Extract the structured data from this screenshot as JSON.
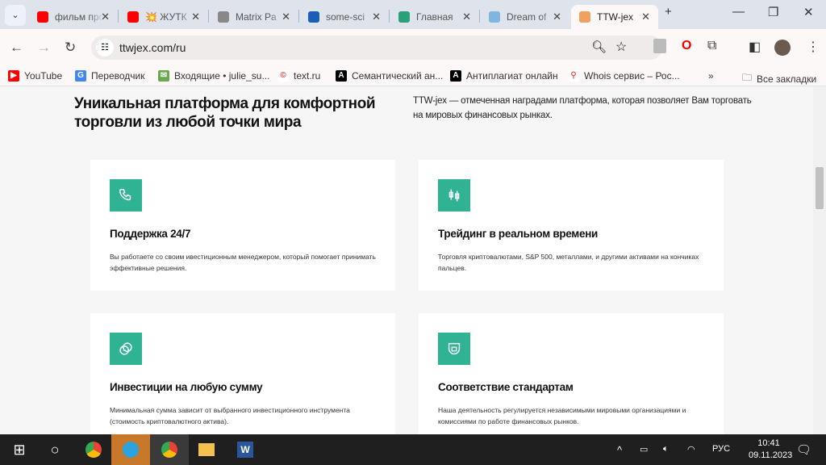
{
  "browser": {
    "tabs": [
      {
        "title": "фильм про",
        "icon": "youtube-icon",
        "color": "#ff0000"
      },
      {
        "title": "💥 ЖУТК",
        "icon": "youtube-icon",
        "color": "#ff0000"
      },
      {
        "title": "Matrix Pa",
        "icon": "matrix-icon",
        "color": "#888888"
      },
      {
        "title": "some-sci",
        "icon": "graduation-icon",
        "color": "#1a5fb4"
      },
      {
        "title": "Главная",
        "icon": "v-logo-icon",
        "color": "#2aa07a"
      },
      {
        "title": "Dream of",
        "icon": "dream-icon",
        "color": "#7fb6e0"
      },
      {
        "title": "TTW-jex",
        "icon": "ttwjex-icon",
        "color": "#f0a060",
        "active": true
      }
    ],
    "url": "ttwjex.com/ru",
    "bookmarks": [
      {
        "label": "YouTube",
        "icon": "youtube-icon"
      },
      {
        "label": "Переводчик",
        "icon": "translate-icon"
      },
      {
        "label": "Входящие • julie_su...",
        "icon": "mail-icon"
      },
      {
        "label": "text.ru",
        "icon": "copyright-icon"
      },
      {
        "label": "Семантический ан...",
        "icon": "a-icon"
      },
      {
        "label": "Антиплагиат онлайн",
        "icon": "a-icon"
      },
      {
        "label": "Whois сервис – Рос...",
        "icon": "search-icon"
      }
    ],
    "all_bookmarks": "Все закладки"
  },
  "page": {
    "heading": "Уникальная платформа для комфортной торговли из любой точки мира",
    "lead": "TTW-jex — отмеченная наградами платформа, которая позволяет Вам торговать на мировых финансовых рынках.",
    "accent": "#2fb393",
    "features": [
      {
        "icon": "phone-icon",
        "title": "Поддержка 24/7",
        "desc": "Вы работаете со своим ивестиционным менеджером, который помогает принимать эффективные решения."
      },
      {
        "icon": "candlestick-icon",
        "title": "Трейдинг в реальном времени",
        "desc": "Торговля криптовалютами, S&P 500, металлами, и другими активами на кончиках пальцев."
      },
      {
        "icon": "coins-icon",
        "title": "Инвестиции на любую сумму",
        "desc": "Минимальная сумма зависит от выбранного инвестиционного инструмента (стоимость криптовалютного актива)."
      },
      {
        "icon": "shield-icon",
        "title": "Соответствие стандартам",
        "desc": "Наша деятельность регулируется независимыми мировыми организациями и комиссиями по работе финансовых рынков."
      }
    ]
  },
  "taskbar": {
    "lang": "РУС",
    "time": "10:41",
    "date": "09.11.2023"
  }
}
